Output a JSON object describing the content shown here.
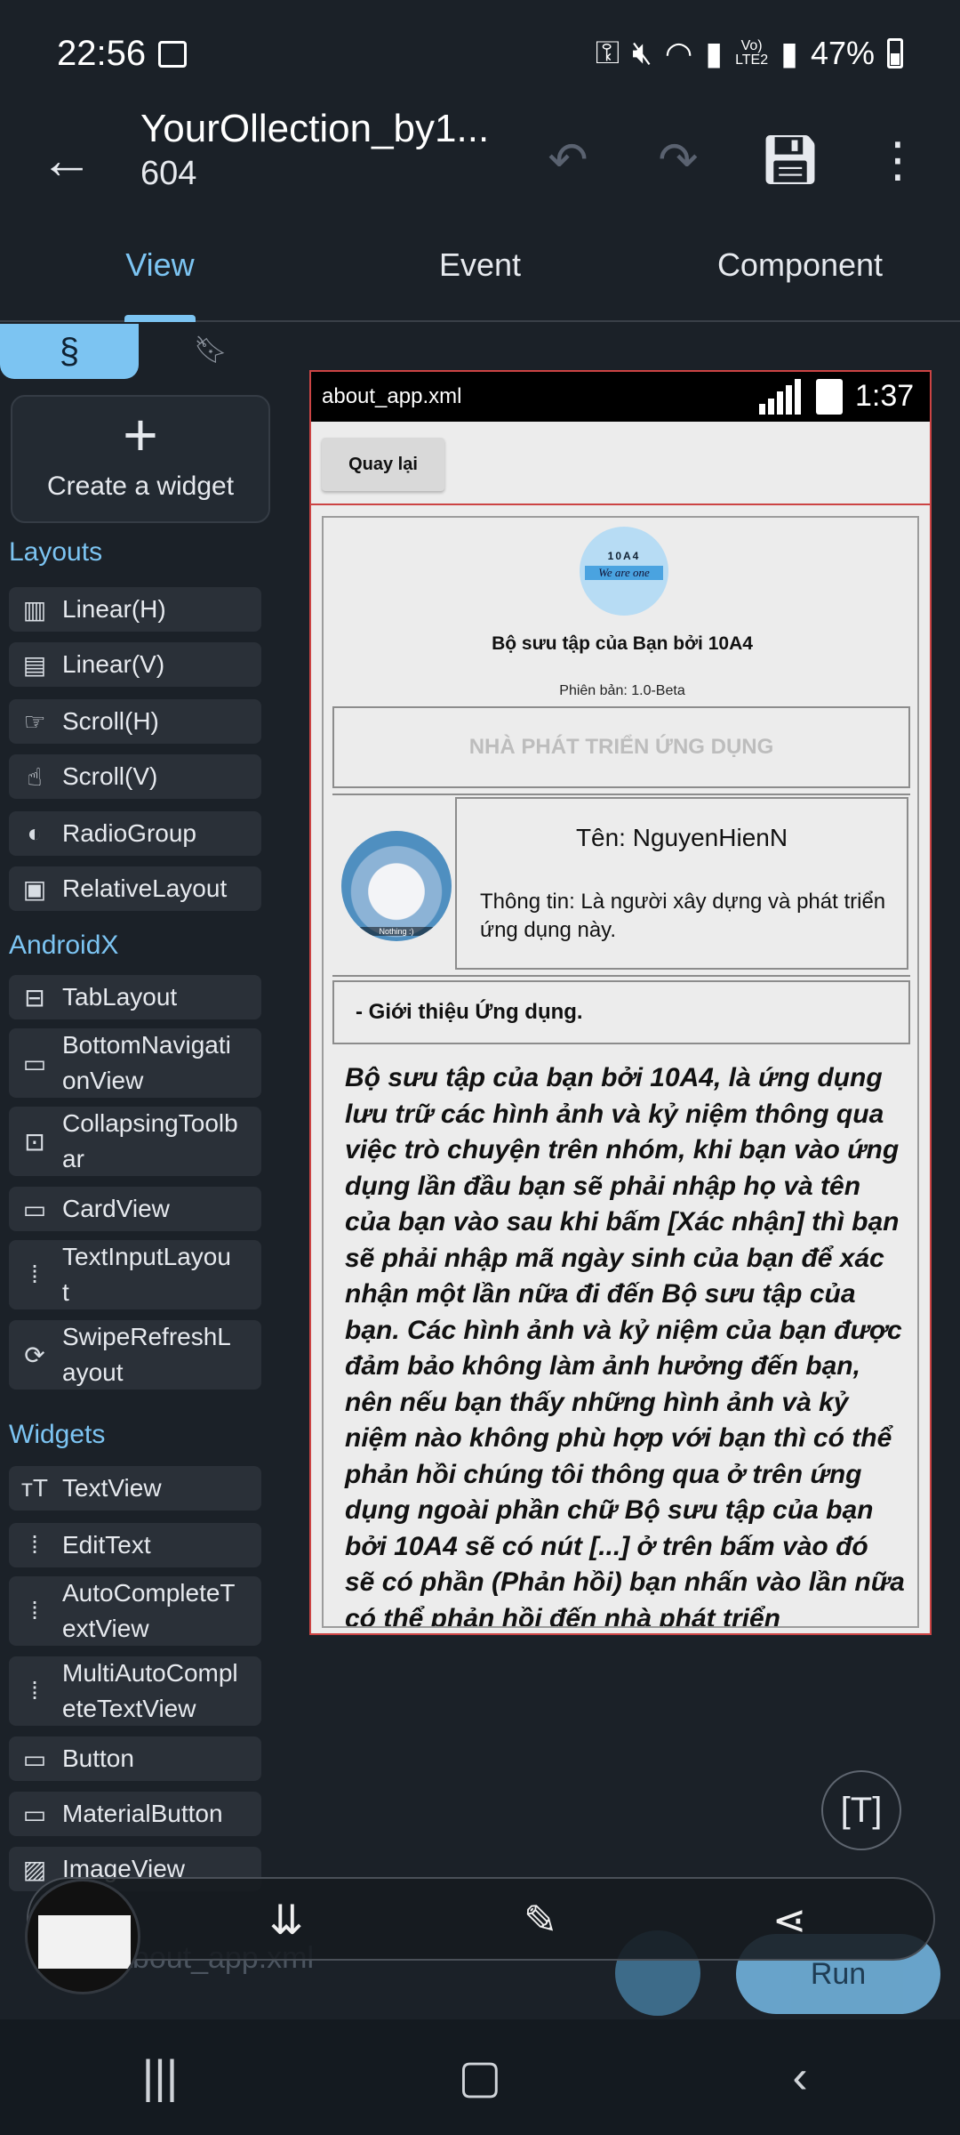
{
  "status_bar": {
    "time": "22:56",
    "signal_label_top": "Vo)",
    "signal_label_bottom": "LTE2",
    "battery": "47%"
  },
  "app_bar": {
    "title": "YourOllection_by1...",
    "subtitle": "604"
  },
  "tabs": [
    {
      "label": "View",
      "active": true
    },
    {
      "label": "Event",
      "active": false
    },
    {
      "label": "Component",
      "active": false
    }
  ],
  "palette": {
    "create_label": "Create a widget",
    "sections": {
      "layouts": "Layouts",
      "androidx": "AndroidX",
      "widgets": "Widgets"
    },
    "layouts": [
      {
        "icon": "columns-icon",
        "label": "Linear(H)"
      },
      {
        "icon": "rows-icon",
        "label": "Linear(V)"
      },
      {
        "icon": "swipe-horizontal-icon",
        "label": "Scroll(H)"
      },
      {
        "icon": "swipe-vertical-icon",
        "label": "Scroll(V)"
      },
      {
        "icon": "radio-icon",
        "label": "RadioGroup"
      },
      {
        "icon": "relative-layout-icon",
        "label": "RelativeLayout"
      }
    ],
    "androidx": [
      {
        "icon": "tab-layout-icon",
        "label": "TabLayout"
      },
      {
        "icon": "bottom-nav-icon",
        "label": "BottomNavigati\nonView"
      },
      {
        "icon": "collapsing-toolbar-icon",
        "label": "CollapsingToolb\nar"
      },
      {
        "icon": "card-icon",
        "label": "CardView"
      },
      {
        "icon": "text-input-icon",
        "label": "TextInputLayou\nt"
      },
      {
        "icon": "refresh-icon",
        "label": "SwipeRefreshL\nayout"
      }
    ],
    "widgets": [
      {
        "icon": "text-icon",
        "label": "TextView"
      },
      {
        "icon": "edit-text-icon",
        "label": "EditText"
      },
      {
        "icon": "edit-text-icon",
        "label": "AutoCompleteT\nextView"
      },
      {
        "icon": "edit-text-icon",
        "label": "MultiAutoCompl\neteTextView"
      },
      {
        "icon": "button-icon",
        "label": "Button"
      },
      {
        "icon": "button-icon",
        "label": "MaterialButton"
      },
      {
        "icon": "image-icon",
        "label": "ImageView"
      }
    ]
  },
  "preview": {
    "file_name": "about_app.xml",
    "clock": "1:37",
    "back_button": "Quay lại",
    "logo_line1": "10A4",
    "logo_line2": "We are one",
    "app_title": "Bộ sưu tập của Bạn bởi 10A4",
    "version": "Phiên bản: 1.0-Beta",
    "developer_header": "NHÀ PHÁT TRIỂN ỨNG DỤNG",
    "avatar_caption": "Nothing :)",
    "dev_name": "Tên: NguyenHienN",
    "dev_info": "Thông tin: Là người xây dựng và phát triển ứng dụng này.",
    "intro_header": "- Giới thiệu Ứng dụng.",
    "description": "Bộ sưu tập của bạn bởi 10A4, là ứng dụng lưu trữ các hình ảnh và kỷ niệm thông qua việc trò chuyện trên nhóm, khi bạn vào ứng dụng lần đầu bạn sẽ phải nhập họ và tên của bạn vào sau khi bấm [Xác nhận] thì bạn sẽ phải nhập mã ngày sinh của bạn để xác nhận một lần nữa đi đến Bộ sưu tập của bạn. Các hình ảnh và kỷ niệm của bạn được đảm bảo không làm ảnh hưởng đến bạn, nên nếu bạn thấy những hình ảnh và kỷ niệm nào không phù hợp với bạn thì có thể phản hồi chúng tôi thông qua ở trên ứng dụng ngoài phần chữ Bộ sưu tập của bạn bởi 10A4 sẽ có nút [...] ở trên bấm vào đó sẽ có phần (Phản hồi) bạn nhấn vào lần nữa có thể phản hồi đến nhà phát triển"
  },
  "bottom_bar": {
    "file_label": "about_app.xml",
    "run_label": "Run"
  },
  "accent_color": "#7cc4f2"
}
